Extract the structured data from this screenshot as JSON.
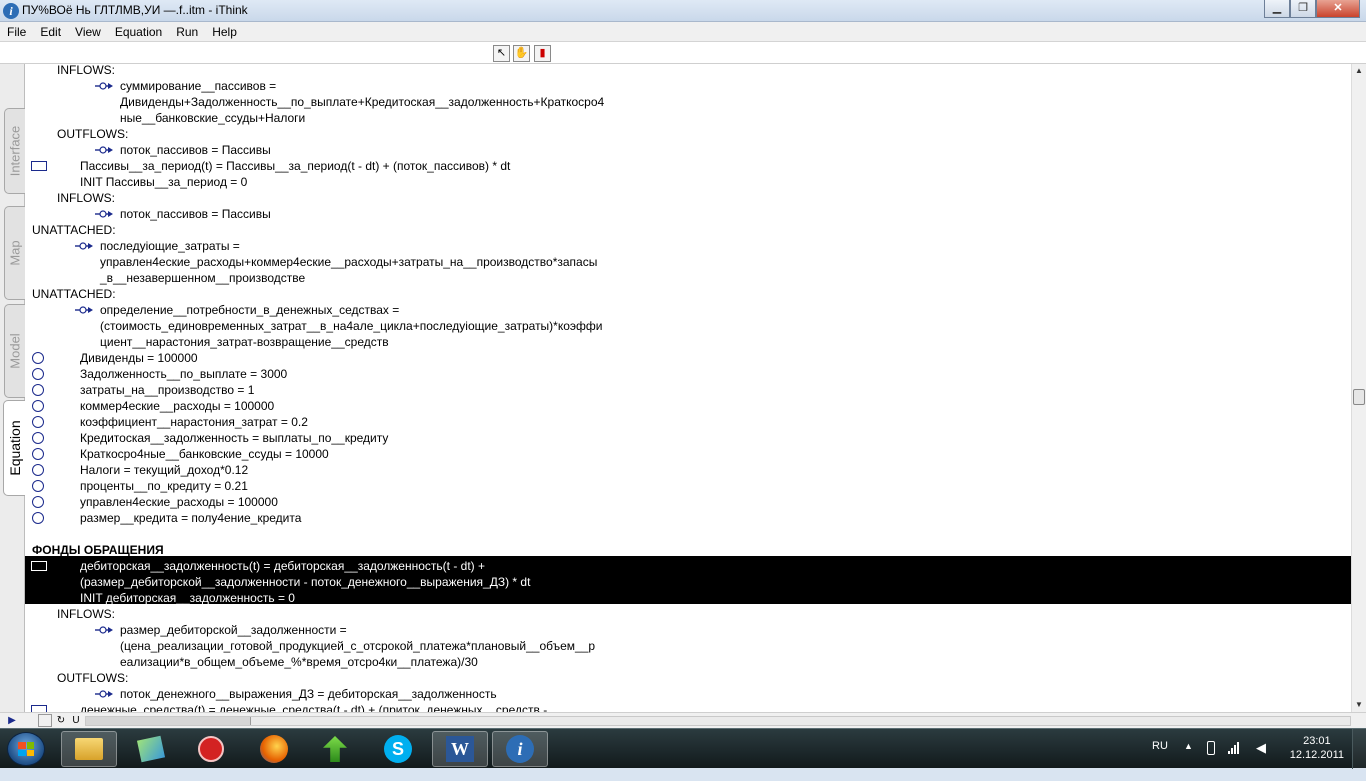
{
  "window": {
    "title": "ПУ%ВОё Нь  ГЛТЛМВ,УИ —.f..itm - iThink",
    "app_icon": "i",
    "minimize": "▁",
    "maximize": "❐",
    "close": "✕"
  },
  "menu": [
    "File",
    "Edit",
    "View",
    "Equation",
    "Run",
    "Help"
  ],
  "tools": {
    "pointer": "↖",
    "hand": "✋",
    "dynamite": "▮"
  },
  "tabs": {
    "interface": "Interface",
    "map": "Map",
    "model": "Model",
    "equation": "Equation"
  },
  "equations": [
    {
      "text": "INFLOWS:",
      "symbol": "none"
    },
    {
      "text": "суммирование__пассивов =",
      "symbol": "flow"
    },
    {
      "text": "Дивиденды+Задолженность__по_выплате+Кредитоская__задолженность+Краткосро4",
      "symbol": "none"
    },
    {
      "text": "ные__банковские_ссуды+Налоги",
      "symbol": "none"
    },
    {
      "text": "OUTFLOWS:",
      "symbol": "none"
    },
    {
      "text": "поток_пассивов = Пассивы",
      "symbol": "flow"
    },
    {
      "text": "Пассивы__за_период(t) = Пассивы__за_период(t - dt) + (поток_пассивов) * dt",
      "symbol": "stock"
    },
    {
      "text": "INIT Пассивы__за_период = 0",
      "symbol": "none"
    },
    {
      "text": "INFLOWS:",
      "symbol": "none"
    },
    {
      "text": "поток_пассивов = Пассивы",
      "symbol": "flow"
    },
    {
      "text": "UNATTACHED:",
      "symbol": "none"
    },
    {
      "text": "последуiощие_затраты =",
      "symbol": "flow"
    },
    {
      "text": "управлен4еские_расходы+коммер4еские__расходы+затраты_на__производство*запасы",
      "symbol": "none"
    },
    {
      "text": "_в__незавершенном__производстве",
      "symbol": "none"
    },
    {
      "text": "UNATTACHED:",
      "symbol": "none"
    },
    {
      "text": "определение__потребности_в_денежных_седствах =",
      "symbol": "flow"
    },
    {
      "text": "(стоимость_единовременных_затрат__в_на4але_цикла+последуiощие_затраты)*коэффи",
      "symbol": "none"
    },
    {
      "text": "циент__нарастония_затрат-возвращение__средств",
      "symbol": "none"
    },
    {
      "text": "Дивиденды = 100000",
      "symbol": "converter"
    },
    {
      "text": "Задолженность__по_выплате = 3000",
      "symbol": "converter"
    },
    {
      "text": "затраты_на__производство = 1",
      "symbol": "converter"
    },
    {
      "text": "коммер4еские__расходы = 100000",
      "symbol": "converter"
    },
    {
      "text": "коэффициент__нарастония_затрат = 0.2",
      "symbol": "converter"
    },
    {
      "text": "Кредитоская__задолженность = выплаты_по__кредиту",
      "symbol": "converter"
    },
    {
      "text": "Краткосро4ные__банковские_ссуды = 10000",
      "symbol": "converter"
    },
    {
      "text": "Налоги = текущий_доход*0.12",
      "symbol": "converter"
    },
    {
      "text": "проценты__по_кредиту = 0.21",
      "symbol": "converter"
    },
    {
      "text": "управлен4еские_расходы = 100000",
      "symbol": "converter"
    },
    {
      "text": "размер__кредита = полу4ение_кредита",
      "symbol": "converter"
    },
    {
      "text": "",
      "symbol": "none"
    },
    {
      "text": "ФОНДЫ ОБРАЩЕНИЯ",
      "symbol": "header"
    },
    {
      "text": "дебиторская__задолженность(t) = дебиторская__задолженность(t - dt) +",
      "symbol": "stock",
      "highlight": true
    },
    {
      "text": "(размер_дебиторской__задолженности - поток_денежного__выражения_ДЗ) * dt",
      "symbol": "none",
      "highlight": true
    },
    {
      "text": "INIT дебиторская__задолженность = 0",
      "symbol": "none",
      "highlight": true
    },
    {
      "text": "INFLOWS:",
      "symbol": "none"
    },
    {
      "text": "размер_дебиторской__задолженности =",
      "symbol": "flow"
    },
    {
      "text": "(цена_реализации_готовой_продукцией_с_отсрокой_платежа*плановый__объем__р",
      "symbol": "none"
    },
    {
      "text": "еализации*в_общем_объеме_%*время_отсро4ки__платежа)/30",
      "symbol": "none"
    },
    {
      "text": "OUTFLOWS:",
      "symbol": "none"
    },
    {
      "text": "поток_денежного__выражения_ДЗ = дебиторская__задолженность",
      "symbol": "flow"
    },
    {
      "text": "денежные_средства(t) = денежные_средства(t - dt) + (приток_денежных__средств -",
      "symbol": "stock"
    }
  ],
  "scrollbar": {
    "up": "▲",
    "down": "▼"
  },
  "bottom": {
    "run": "▶",
    "restart": "↻",
    "pause": "U"
  },
  "tray": {
    "language": "RU",
    "time": "23:01",
    "date": "12.12.2011"
  },
  "colors": {
    "symbol_blue": "#1b2a8c",
    "highlight": "#000000"
  }
}
